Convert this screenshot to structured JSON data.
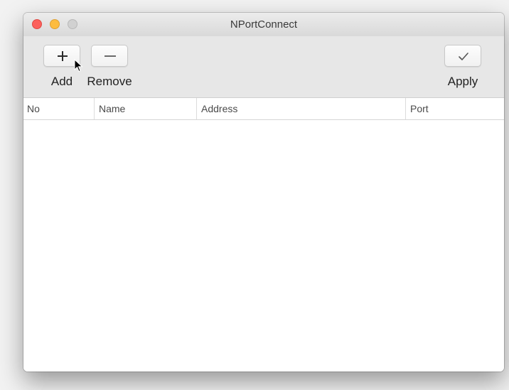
{
  "window": {
    "title": "NPortConnect",
    "traffic_lights": [
      "close",
      "minimize",
      "zoom"
    ]
  },
  "toolbar": {
    "add": {
      "label": "Add",
      "icon": "plus-icon"
    },
    "remove": {
      "label": "Remove",
      "icon": "minus-icon"
    },
    "apply": {
      "label": "Apply",
      "icon": "checkmark-icon"
    }
  },
  "table": {
    "columns": [
      "No",
      "Name",
      "Address",
      "Port"
    ],
    "rows": []
  },
  "colors": {
    "close": "#fc605c",
    "minimize": "#fdbc40",
    "zoom_inactive": "#d1d1d1"
  }
}
